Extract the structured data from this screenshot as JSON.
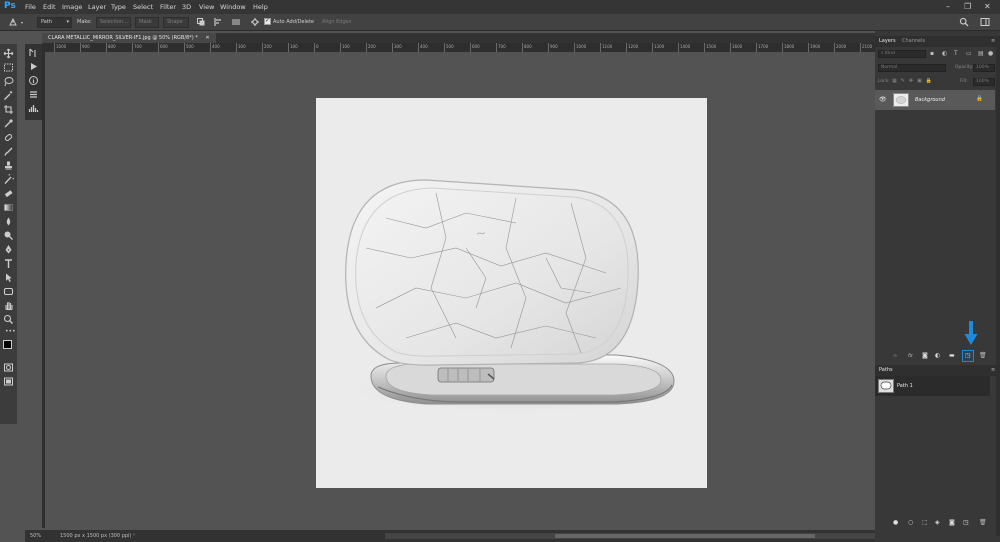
{
  "app": {
    "logo": "Ps",
    "menu": [
      "File",
      "Edit",
      "Image",
      "Layer",
      "Type",
      "Select",
      "Filter",
      "3D",
      "View",
      "Window",
      "Help"
    ]
  },
  "options": {
    "mode": "Path",
    "make_label": "Make:",
    "selection_btn": "Selection...",
    "mask_btn": "Mask",
    "shape_btn": "Shape",
    "auto_add_delete": "Auto Add/Delete",
    "align_edges": "Align Edges",
    "auto_add_checked": true
  },
  "document": {
    "tab_title": "CLARA METALLIC_MIRROR_SILVER-IF1.jpg @ 50% (RGB/8*) *",
    "ruler_ticks": [
      "1000",
      "900",
      "800",
      "700",
      "600",
      "500",
      "400",
      "300",
      "200",
      "100",
      "0",
      "100",
      "200",
      "300",
      "400",
      "500",
      "600",
      "700",
      "800",
      "900",
      "1000",
      "1100",
      "1200",
      "1300",
      "1400",
      "1500",
      "1600",
      "1700",
      "1800",
      "1900",
      "2000",
      "2100"
    ]
  },
  "status": {
    "zoom": "50%",
    "doc_info": "1500 px x 1500 px (300 ppi)"
  },
  "layers_panel": {
    "tabs": [
      "Layers",
      "Channels"
    ],
    "active_tab": "Layers",
    "search_placeholder": "Kind",
    "blend_mode": "Normal",
    "opacity_label": "Opacity:",
    "opacity_value": "100%",
    "lock_label": "Lock:",
    "fill_label": "Fill:",
    "fill_value": "100%",
    "layers": [
      {
        "name": "Background",
        "visible": true,
        "locked": true
      }
    ]
  },
  "paths_panel": {
    "title": "Paths",
    "paths": [
      {
        "name": "Path 1"
      }
    ]
  },
  "colors": {
    "accent": "#1f8ad2",
    "highlight_arrow": "#1a8bde"
  }
}
